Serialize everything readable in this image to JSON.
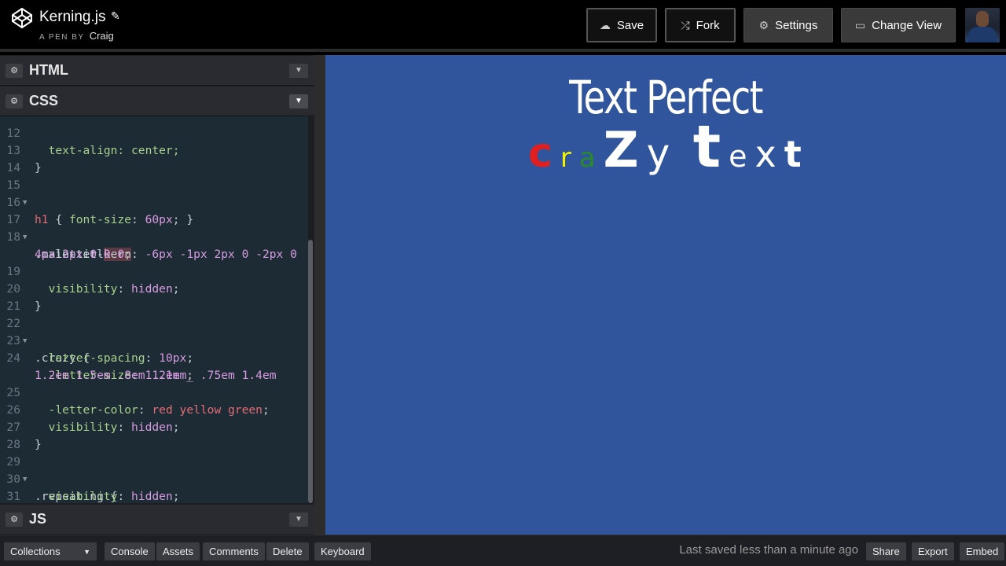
{
  "header": {
    "title": "Kerning.js",
    "byline_prefix": "A PEN BY",
    "author": "Craig",
    "buttons": {
      "save": "Save",
      "fork": "Fork",
      "settings": "Settings",
      "change_view": "Change View"
    }
  },
  "panels": {
    "html": "HTML",
    "css": "CSS",
    "js": "JS"
  },
  "code_lines": [
    {
      "n": "12",
      "text": "  text-align: center;"
    },
    {
      "n": "13",
      "text": "}"
    },
    {
      "n": "14",
      "text": ""
    },
    {
      "n": "15",
      "sel": "h1",
      "rest": " { ",
      "prop": "font-size",
      "colon": ": ",
      "val": "60px",
      "end": "; }"
    },
    {
      "n": "16",
      "text": ""
    },
    {
      "n": "17",
      "text": ".main-title {"
    },
    {
      "n": "18a",
      "pre": "  -letter-",
      "kw": "kern",
      "post": ": ",
      "val": "-6px -1px 2px 0 -2px 0"
    },
    {
      "n": "18b",
      "val": "4px 2px 0 0 0",
      "end": ";"
    },
    {
      "n": "19",
      "prop": "visibility",
      "val": "hidden"
    },
    {
      "n": "20",
      "text": "}"
    },
    {
      "n": "21",
      "text": ""
    },
    {
      "n": "22",
      "text": ".crazy {"
    },
    {
      "n": "23",
      "prop": "letter-spacing",
      "val": "10px"
    },
    {
      "n": "24a",
      "prop": "-letter-size",
      "val": "1.2em _ .75em 1.4em"
    },
    {
      "n": "24b",
      "val": "1.2em 1.5em .8em 1.1em",
      "end": ";"
    },
    {
      "n": "25",
      "prop": "-letter-color",
      "val": "red yellow green"
    },
    {
      "n": "26",
      "prop": "visibility",
      "val": "hidden"
    },
    {
      "n": "27",
      "text": "}"
    },
    {
      "n": "28",
      "text": ""
    },
    {
      "n": "29",
      "text": ".repeating {"
    },
    {
      "n": "30",
      "prop": "visibility",
      "val": "hidden"
    },
    {
      "n": "31",
      "text": "}"
    }
  ],
  "line_numbers": {
    "l12": "12",
    "l13": "13",
    "l14": "14",
    "l15": "15",
    "l16": "16",
    "l17": "17",
    "l18": "18",
    "l19": "19",
    "l20": "20",
    "l21": "21",
    "l22": "22",
    "l23": "23",
    "l24": "24",
    "l25": "25",
    "l26": "26",
    "l27": "27",
    "l28": "28",
    "l29": "29",
    "l30": "30",
    "l31": "31"
  },
  "preview": {
    "main_title": "Text Perfect",
    "crazy_letters": [
      {
        "ch": "c",
        "color": "#e02020",
        "size": "52px"
      },
      {
        "ch": "r",
        "color": "#f2f200",
        "size": "34px"
      },
      {
        "ch": "a",
        "color": "#2a8a2a",
        "size": "34px"
      },
      {
        "ch": "Z",
        "color": "#ffffff",
        "size": "62px"
      },
      {
        "ch": "y",
        "color": "#ffffff",
        "size": "50px"
      },
      {
        "ch": " ",
        "color": "#ffffff",
        "size": "30px"
      },
      {
        "ch": "t",
        "color": "#ffffff",
        "size": "74px"
      },
      {
        "ch": "e",
        "color": "#ffffff",
        "size": "38px"
      },
      {
        "ch": "x",
        "color": "#ffffff",
        "size": "46px"
      },
      {
        "ch": "t",
        "color": "#ffffff",
        "size": "46px"
      }
    ],
    "background": "#30559d"
  },
  "footer": {
    "collections": "Collections",
    "console": "Console",
    "assets": "Assets",
    "comments": "Comments",
    "delete": "Delete",
    "keyboard": "Keyboard",
    "saved_status": "Last saved less than a minute ago",
    "share": "Share",
    "export": "Export",
    "embed": "Embed"
  }
}
